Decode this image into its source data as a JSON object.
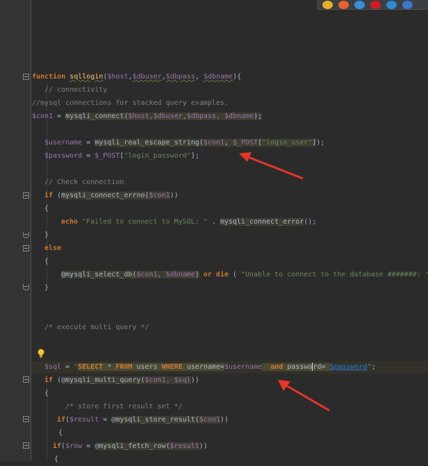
{
  "browser_icons": [
    {
      "name": "chrome-icon",
      "color": "#e8b02a"
    },
    {
      "name": "firefox-icon",
      "color": "#e5622b"
    },
    {
      "name": "safari-icon",
      "color": "#3a8fd9"
    },
    {
      "name": "opera-icon",
      "color": "#d11a2a"
    },
    {
      "name": "ie-icon",
      "color": "#2a8ad6"
    },
    {
      "name": "edge-icon",
      "color": "#3a78c9"
    }
  ],
  "code": {
    "l1": {
      "kw": "function",
      "fname": "sqllogin",
      "open": "(",
      "p1": "$host",
      "c1": ",",
      "p2": "$dbuser",
      "c2": ",",
      "p3": "$dbpass",
      "c3": ", ",
      "p4": "$dbname",
      "close": "){"
    },
    "l2": "// connectivity",
    "l3": "//mysql connections for stacked query examples.",
    "l4": {
      "v": "$con1",
      "eq": " = ",
      "fn": "mysqli_connect",
      "open": "(",
      "args": "$host,$dbuser,$dbpass, $dbname",
      "close": ");"
    },
    "l5": {
      "v": "$username",
      "eq": " = ",
      "fn": "mysqli_real_escape_string",
      "open": "(",
      "a1": "$con1",
      "sep": ", ",
      "a2": "$_POST",
      "br1": "[",
      "s": "\"login_user\"",
      "br2": "]",
      "close": ");"
    },
    "l6": {
      "v": "$password",
      "eq": " = ",
      "a": "$_POST",
      "br1": "[",
      "s": "\"login_password\"",
      "br2": "];"
    },
    "l7": "// Check connection",
    "l8": {
      "kw": "if",
      "sp": " (",
      "fn": "mysqli_connect_errno",
      "open": "(",
      "a": "$con1",
      "close": "))"
    },
    "l9": "{",
    "l10": {
      "kw": "echo",
      "sp": " ",
      "s": "\"Failed to connect to MySQL: \"",
      "dot": " . ",
      "fn": "mysqli_connect_error",
      "tail": "();"
    },
    "l11": "}",
    "l12": "else",
    "l13": "{",
    "l14": {
      "at": "@",
      "fn": "mysqli_select_db",
      "open": "(",
      "a": "$con1, $dbname",
      "close": ")",
      "kw": " or die",
      "sp": " ( ",
      "s": "\"Unable to connect to the database #######: \")"
    },
    "l15": "}",
    "l16": "/* execute multi query */",
    "l17": {
      "v": "$sql",
      "eq": " = ",
      "q": "\"",
      "k1": "SELECT",
      "t1": " * ",
      "k2": "FROM",
      "t2": " users ",
      "k3": "WHERE",
      "t3": " username=",
      "v1": "$username",
      "gap": "  ",
      "k4": "and",
      "t4": " passwo",
      "t5": "rd= ",
      "v2": "$password",
      "q2": "\"",
      "end": ";"
    },
    "l18": {
      "kw": "if",
      "sp": " (@",
      "fn": "mysqli_multi_query",
      "open": "(",
      "a": "$con1, $sql",
      "close": "))"
    },
    "l19": "{",
    "l20": "/* store first result set */",
    "l21": {
      "kw": "if",
      "open": "(",
      "v": "$result",
      "eq": " = @",
      "fn": "mysqli_store_result",
      "a": "$con1",
      "close": "))"
    },
    "l22": "{",
    "l23": {
      "kw": "if",
      "open": "(",
      "v": "$row",
      "eq": " = @",
      "fn": "mysqli_fetch_row",
      "a": "$result",
      "close": "))"
    },
    "l24": "{"
  }
}
